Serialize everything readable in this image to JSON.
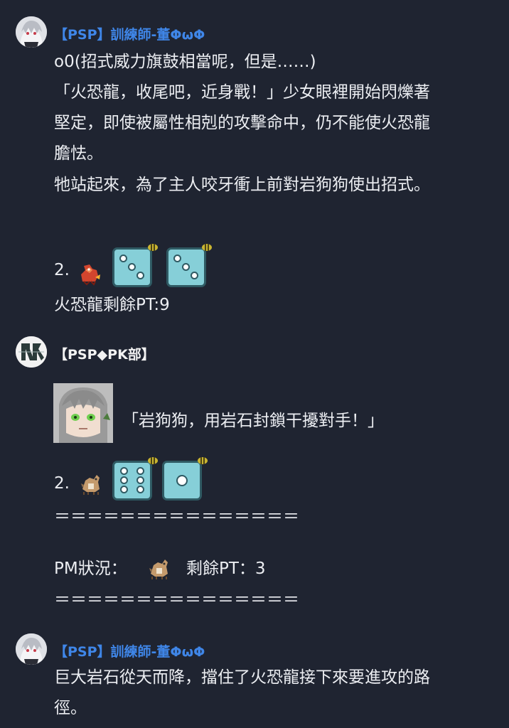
{
  "messages": [
    {
      "author": "【PSP】訓練師-董ΦωΦ",
      "lines": [
        "o0(招式威力旗鼓相當呢，但是……)",
        "「火恐龍，收尾吧，近身戰！」少女眼裡開始閃爍著",
        "堅定，即使被屬性相剋的攻擊命中，仍不能使火恐龍",
        "膽怯。",
        "牠站起來，為了主人咬牙衝上前對岩狗狗使出招式。"
      ],
      "roll_label": "2.",
      "dice": [
        3,
        3
      ],
      "status": "火恐龍剩餘PT:9"
    },
    {
      "author": "【PSP◆PK部】",
      "quote": "「岩狗狗，用岩石封鎖干擾對手！」",
      "roll_label": "2.",
      "dice": [
        6,
        1
      ],
      "separator": "＝＝＝＝＝＝＝＝＝＝＝＝＝＝＝",
      "status_label": "PM狀況：",
      "status_value": "剩餘PT：3"
    },
    {
      "author": "【PSP】訓練師-董ΦωΦ",
      "lines": [
        "巨大岩石從天而降，擋住了火恐龍接下來要進攻的路",
        "徑。"
      ]
    }
  ],
  "colors": {
    "background": "#1f2431",
    "author_blue": "#3f86e8",
    "text": "#eceef2",
    "die_face": "#86cfd8",
    "die_border": "#2f5a63"
  },
  "icons": [
    "trainer-avatar",
    "pk-club-avatar",
    "charmeleon-sprite",
    "rockruff-sprite",
    "dice-icon",
    "bee-icon",
    "character-portrait"
  ]
}
